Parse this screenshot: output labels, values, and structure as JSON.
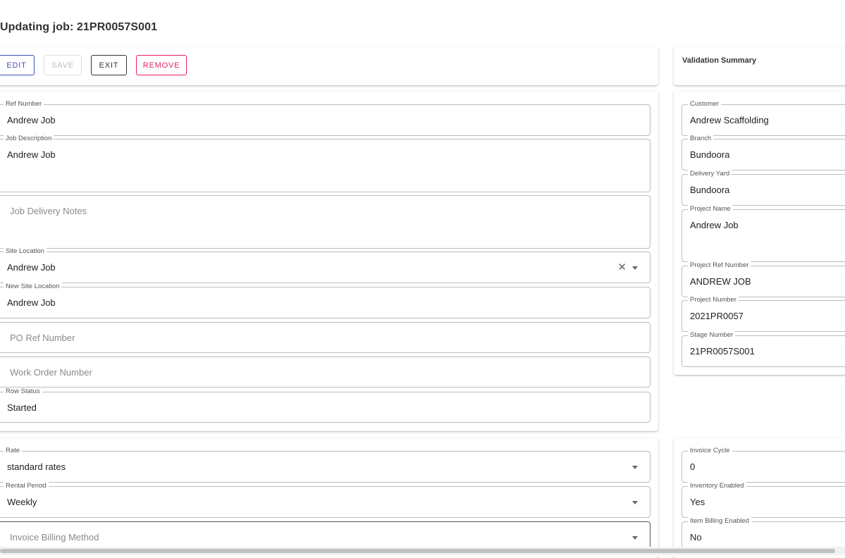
{
  "page": {
    "title": "Updating job: 21PR0057S001"
  },
  "toolbar": {
    "edit": "EDIT",
    "save": "SAVE",
    "exit": "EXIT",
    "remove": "REMOVE"
  },
  "validation": {
    "title": "Validation Summary"
  },
  "job": {
    "ref_number": {
      "label": "Ref Number",
      "value": "Andrew Job"
    },
    "job_description": {
      "label": "Job Description",
      "value": "Andrew Job"
    },
    "delivery_notes": {
      "placeholder": "Job Delivery Notes"
    },
    "site_location": {
      "label": "Site Location",
      "value": "Andrew Job"
    },
    "new_site_location": {
      "label": "New Site Location",
      "value": "Andrew Job"
    },
    "po_ref": {
      "placeholder": "PO Ref Number"
    },
    "work_order": {
      "placeholder": "Work Order Number"
    },
    "row_status": {
      "label": "Row Status",
      "value": "Started"
    }
  },
  "customer": {
    "customer": {
      "label": "Customer",
      "value": "Andrew Scaffolding"
    },
    "branch": {
      "label": "Branch",
      "value": "Bundoora"
    },
    "delivery_yard": {
      "label": "Delivery Yard",
      "value": "Bundoora"
    },
    "project_name": {
      "label": "Project Name",
      "value": "Andrew Job"
    },
    "project_ref": {
      "label": "Project Ref Number",
      "value": "ANDREW JOB"
    },
    "project_number": {
      "label": "Project Number",
      "value": "2021PR0057"
    },
    "stage_number": {
      "label": "Stage Number",
      "value": "21PR0057S001"
    }
  },
  "billing": {
    "rate": {
      "label": "Rate",
      "value": "standard rates"
    },
    "rental_period": {
      "label": "Rental Period",
      "value": "Weekly"
    },
    "invoice_method": {
      "placeholder": "Invoice Billing Method"
    },
    "invoice_cycle": {
      "label": "Invoice Cycle",
      "value": "0"
    },
    "inventory_enabled": {
      "label": "Inventory Enabled",
      "value": "Yes"
    },
    "item_billing": {
      "label": "Item Billing Enabled",
      "value": "No"
    }
  },
  "icons": {
    "clear": "close-icon",
    "dropdown": "arrow-drop-down-icon"
  },
  "colors": {
    "primary": "#3f51b5",
    "danger": "#e91e63",
    "disabled": "#bdbdbd"
  }
}
